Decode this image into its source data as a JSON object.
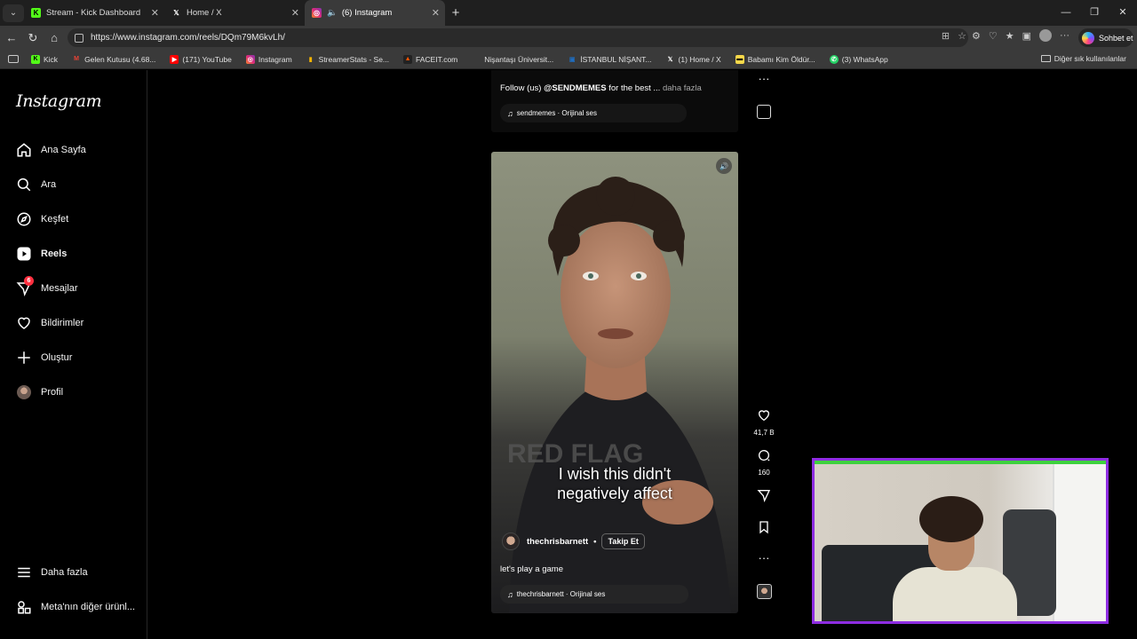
{
  "browser": {
    "tabs": [
      {
        "title": "Stream - Kick Dashboard",
        "icon": "kick-icon",
        "color": "#53fc18"
      },
      {
        "title": "Home / X",
        "icon": "x-icon",
        "color": "#ffffff"
      },
      {
        "title": "(6) Instagram",
        "icon": "instagram-icon",
        "color": "#e1306c",
        "active": true
      }
    ],
    "url": "https://www.instagram.com/reels/DQm79M6kvLh/",
    "copilot_label": "Sohbet et",
    "bookmarks": [
      {
        "label": "Kick",
        "icon": "kick-icon",
        "color": "#53fc18"
      },
      {
        "label": "Gelen Kutusu (4.68...",
        "icon": "gmail-icon",
        "color": "#ea4335"
      },
      {
        "label": "(171) YouTube",
        "icon": "youtube-icon",
        "color": "#ff0000"
      },
      {
        "label": "Instagram",
        "icon": "instagram-icon",
        "color": "#e1306c"
      },
      {
        "label": "StreamerStats - Se...",
        "icon": "stats-icon",
        "color": "#f5b400"
      },
      {
        "label": "FACEIT.com",
        "icon": "faceit-icon",
        "color": "#ff5500"
      },
      {
        "label": "Nişantaşı Üniversit...",
        "icon": "university-icon",
        "color": "#1f3c88"
      },
      {
        "label": "İSTANBUL NİŞANT...",
        "icon": "university-icon",
        "color": "#1f6dbf"
      },
      {
        "label": "(1) Home / X",
        "icon": "x-icon",
        "color": "#ffffff"
      },
      {
        "label": "Babamı Kim Öldür...",
        "icon": "book-icon",
        "color": "#f7d84a"
      },
      {
        "label": "(3) WhatsApp",
        "icon": "whatsapp-icon",
        "color": "#25d366"
      }
    ],
    "other_bookmarks": "Diğer sık kullanılanlar"
  },
  "instagram": {
    "logo": "Instagram",
    "nav": [
      {
        "label": "Ana Sayfa",
        "icon": "home-icon"
      },
      {
        "label": "Ara",
        "icon": "search-icon"
      },
      {
        "label": "Keşfet",
        "icon": "compass-icon"
      },
      {
        "label": "Reels",
        "icon": "reels-icon",
        "active": true
      },
      {
        "label": "Mesajlar",
        "icon": "messenger-icon",
        "badge": "6"
      },
      {
        "label": "Bildirimler",
        "icon": "heart-icon"
      },
      {
        "label": "Oluştur",
        "icon": "plus-icon"
      },
      {
        "label": "Profil",
        "icon": "avatar"
      }
    ],
    "more": "Daha fazla",
    "meta": "Meta'nın diğer ürünl...",
    "prev_reel": {
      "caption_prefix": "Follow (us) ",
      "caption_handle": "@SENDMEMES",
      "caption_suffix": " for the best ...",
      "more_link": "daha fazla",
      "audio": "sendmemes · Orijinal ses"
    },
    "reel": {
      "subtitle_line1": "I wish this didn't",
      "subtitle_line2": "negatively affect",
      "username": "thechrisbarnett",
      "separator": "•",
      "follow": "Takip Et",
      "caption": "let's play a game",
      "audio": "thechrisbarnett · Orijinal ses",
      "likes": "41,7 B",
      "comments": "160"
    }
  }
}
